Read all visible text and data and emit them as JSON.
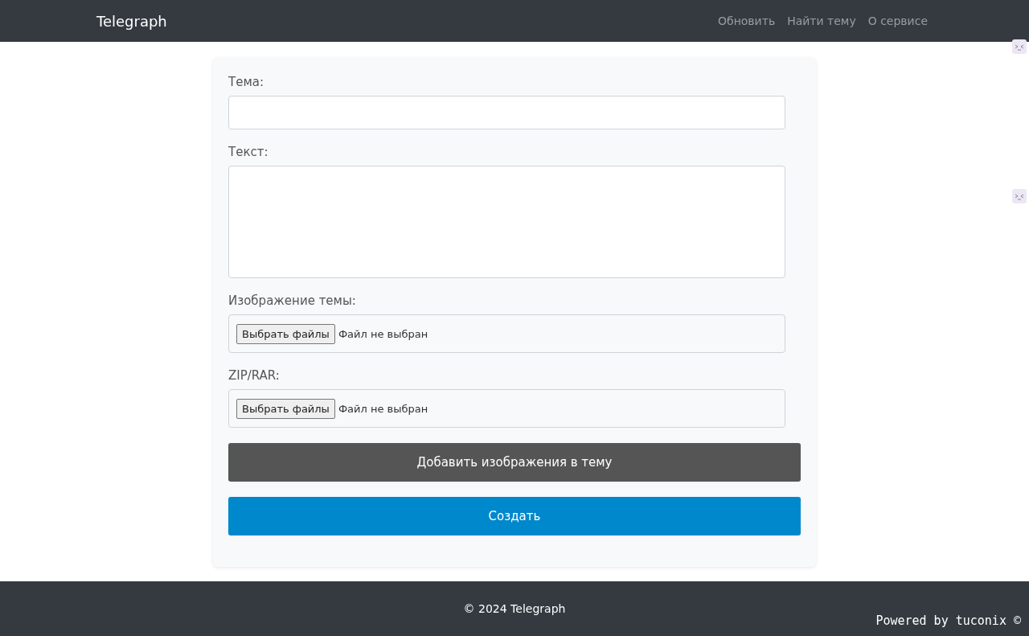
{
  "navbar": {
    "brand": "Telegraph",
    "links": [
      "Обновить",
      "Найти тему",
      "О сервисе"
    ]
  },
  "form": {
    "fields": [
      {
        "kind": "text",
        "label": "Тема:"
      },
      {
        "kind": "textarea",
        "label": "Текст:"
      },
      {
        "kind": "file",
        "label": "Изображение темы:",
        "button": "Выбрать файлы",
        "status": "Файл не выбран"
      },
      {
        "kind": "file",
        "label": "ZIP/RAR:",
        "button": "Выбрать файлы",
        "status": "Файл не выбран"
      }
    ],
    "buttons": [
      {
        "kind": "secondary",
        "label": "Добавить изображения в тему"
      },
      {
        "kind": "primary",
        "label": "Создать"
      }
    ]
  },
  "footer": {
    "copyright": "© 2024 Telegraph",
    "powered": "Powered by tuconix ©"
  }
}
